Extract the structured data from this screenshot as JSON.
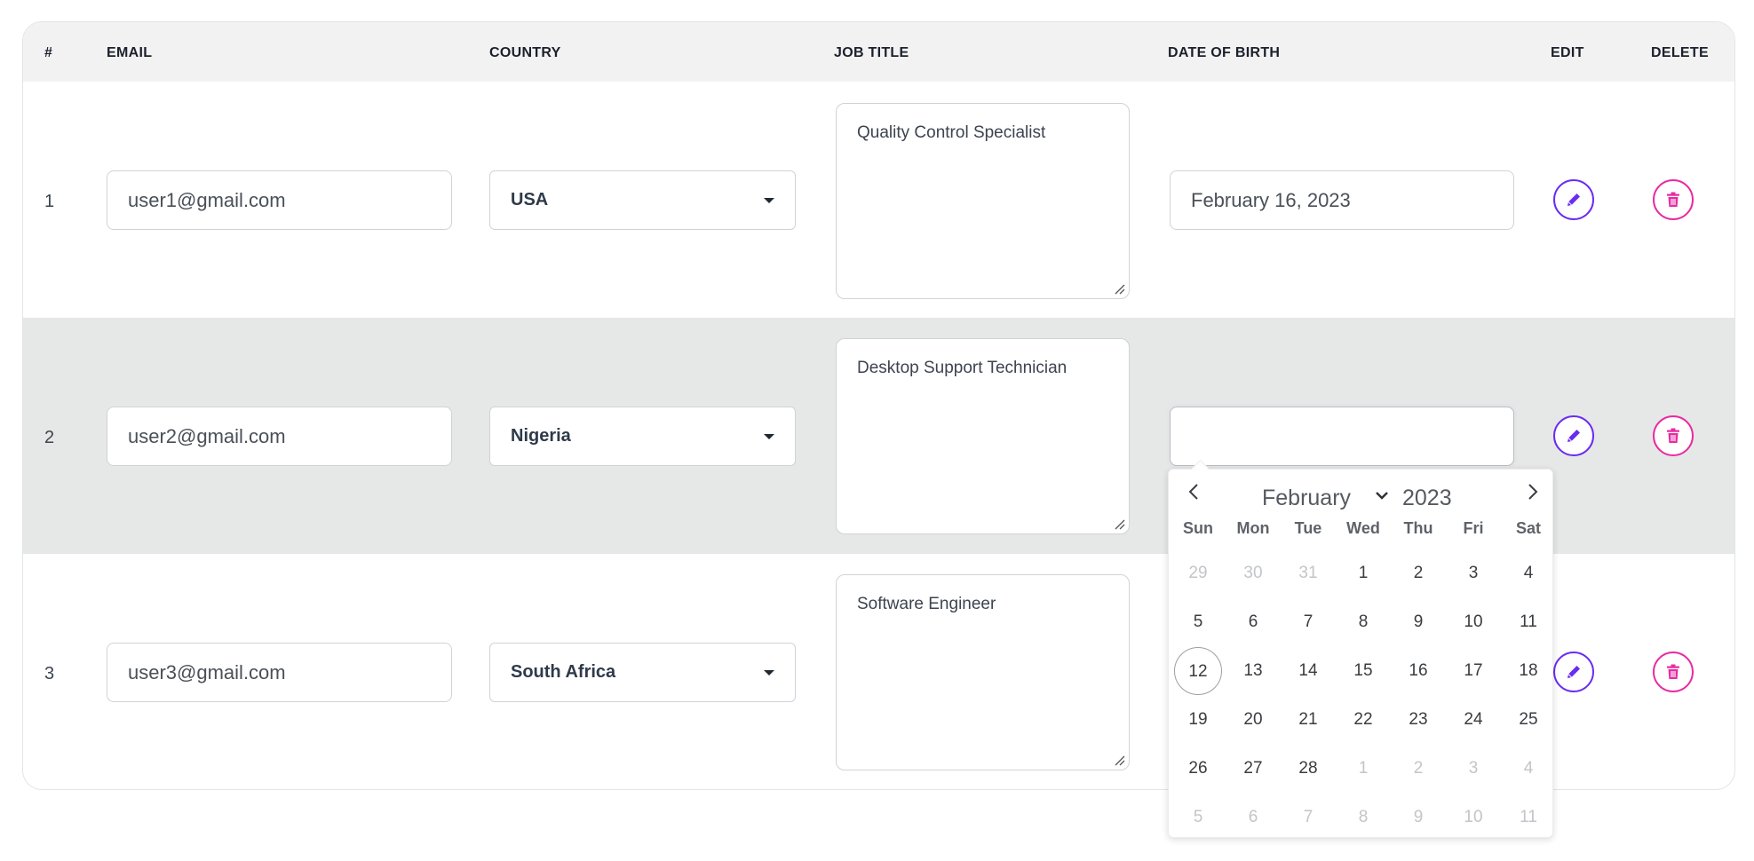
{
  "headers": {
    "num": "#",
    "email": "EMAIL",
    "country": "COUNTRY",
    "job_title": "JOB TITLE",
    "dob": "DATE OF BIRTH",
    "edit": "EDIT",
    "delete": "DELETE"
  },
  "rows": [
    {
      "num": "1",
      "email": "user1@gmail.com",
      "country": "USA",
      "job_title": "Quality Control Specialist",
      "dob": "February 16, 2023"
    },
    {
      "num": "2",
      "email": "user2@gmail.com",
      "country": "Nigeria",
      "job_title": "Desktop Support Technician",
      "dob": ""
    },
    {
      "num": "3",
      "email": "user3@gmail.com",
      "country": "South Africa",
      "job_title": "Software Engineer",
      "dob": ""
    }
  ],
  "calendar": {
    "month": "February",
    "year": "2023",
    "weekdays": [
      "Sun",
      "Mon",
      "Tue",
      "Wed",
      "Thu",
      "Fri",
      "Sat"
    ],
    "weeks": [
      [
        "29",
        "30",
        "31",
        "1",
        "2",
        "3",
        "4"
      ],
      [
        "5",
        "6",
        "7",
        "8",
        "9",
        "10",
        "11"
      ],
      [
        "12",
        "13",
        "14",
        "15",
        "16",
        "17",
        "18"
      ],
      [
        "19",
        "20",
        "21",
        "22",
        "23",
        "24",
        "25"
      ],
      [
        "26",
        "27",
        "28",
        "1",
        "2",
        "3",
        "4"
      ],
      [
        "5",
        "6",
        "7",
        "8",
        "9",
        "10",
        "11"
      ]
    ],
    "today": "12"
  },
  "colors": {
    "edit_accent": "#6a2cf0",
    "delete_accent": "#e82ba2",
    "header_bg": "#f2f2f2",
    "alt_row_bg": "#e6e7e7"
  },
  "icons": {
    "edit": "pencil-icon",
    "delete": "trash-icon",
    "select": "caret-down-icon",
    "calendar_prev": "chevron-left-icon",
    "calendar_next": "chevron-right-icon"
  }
}
